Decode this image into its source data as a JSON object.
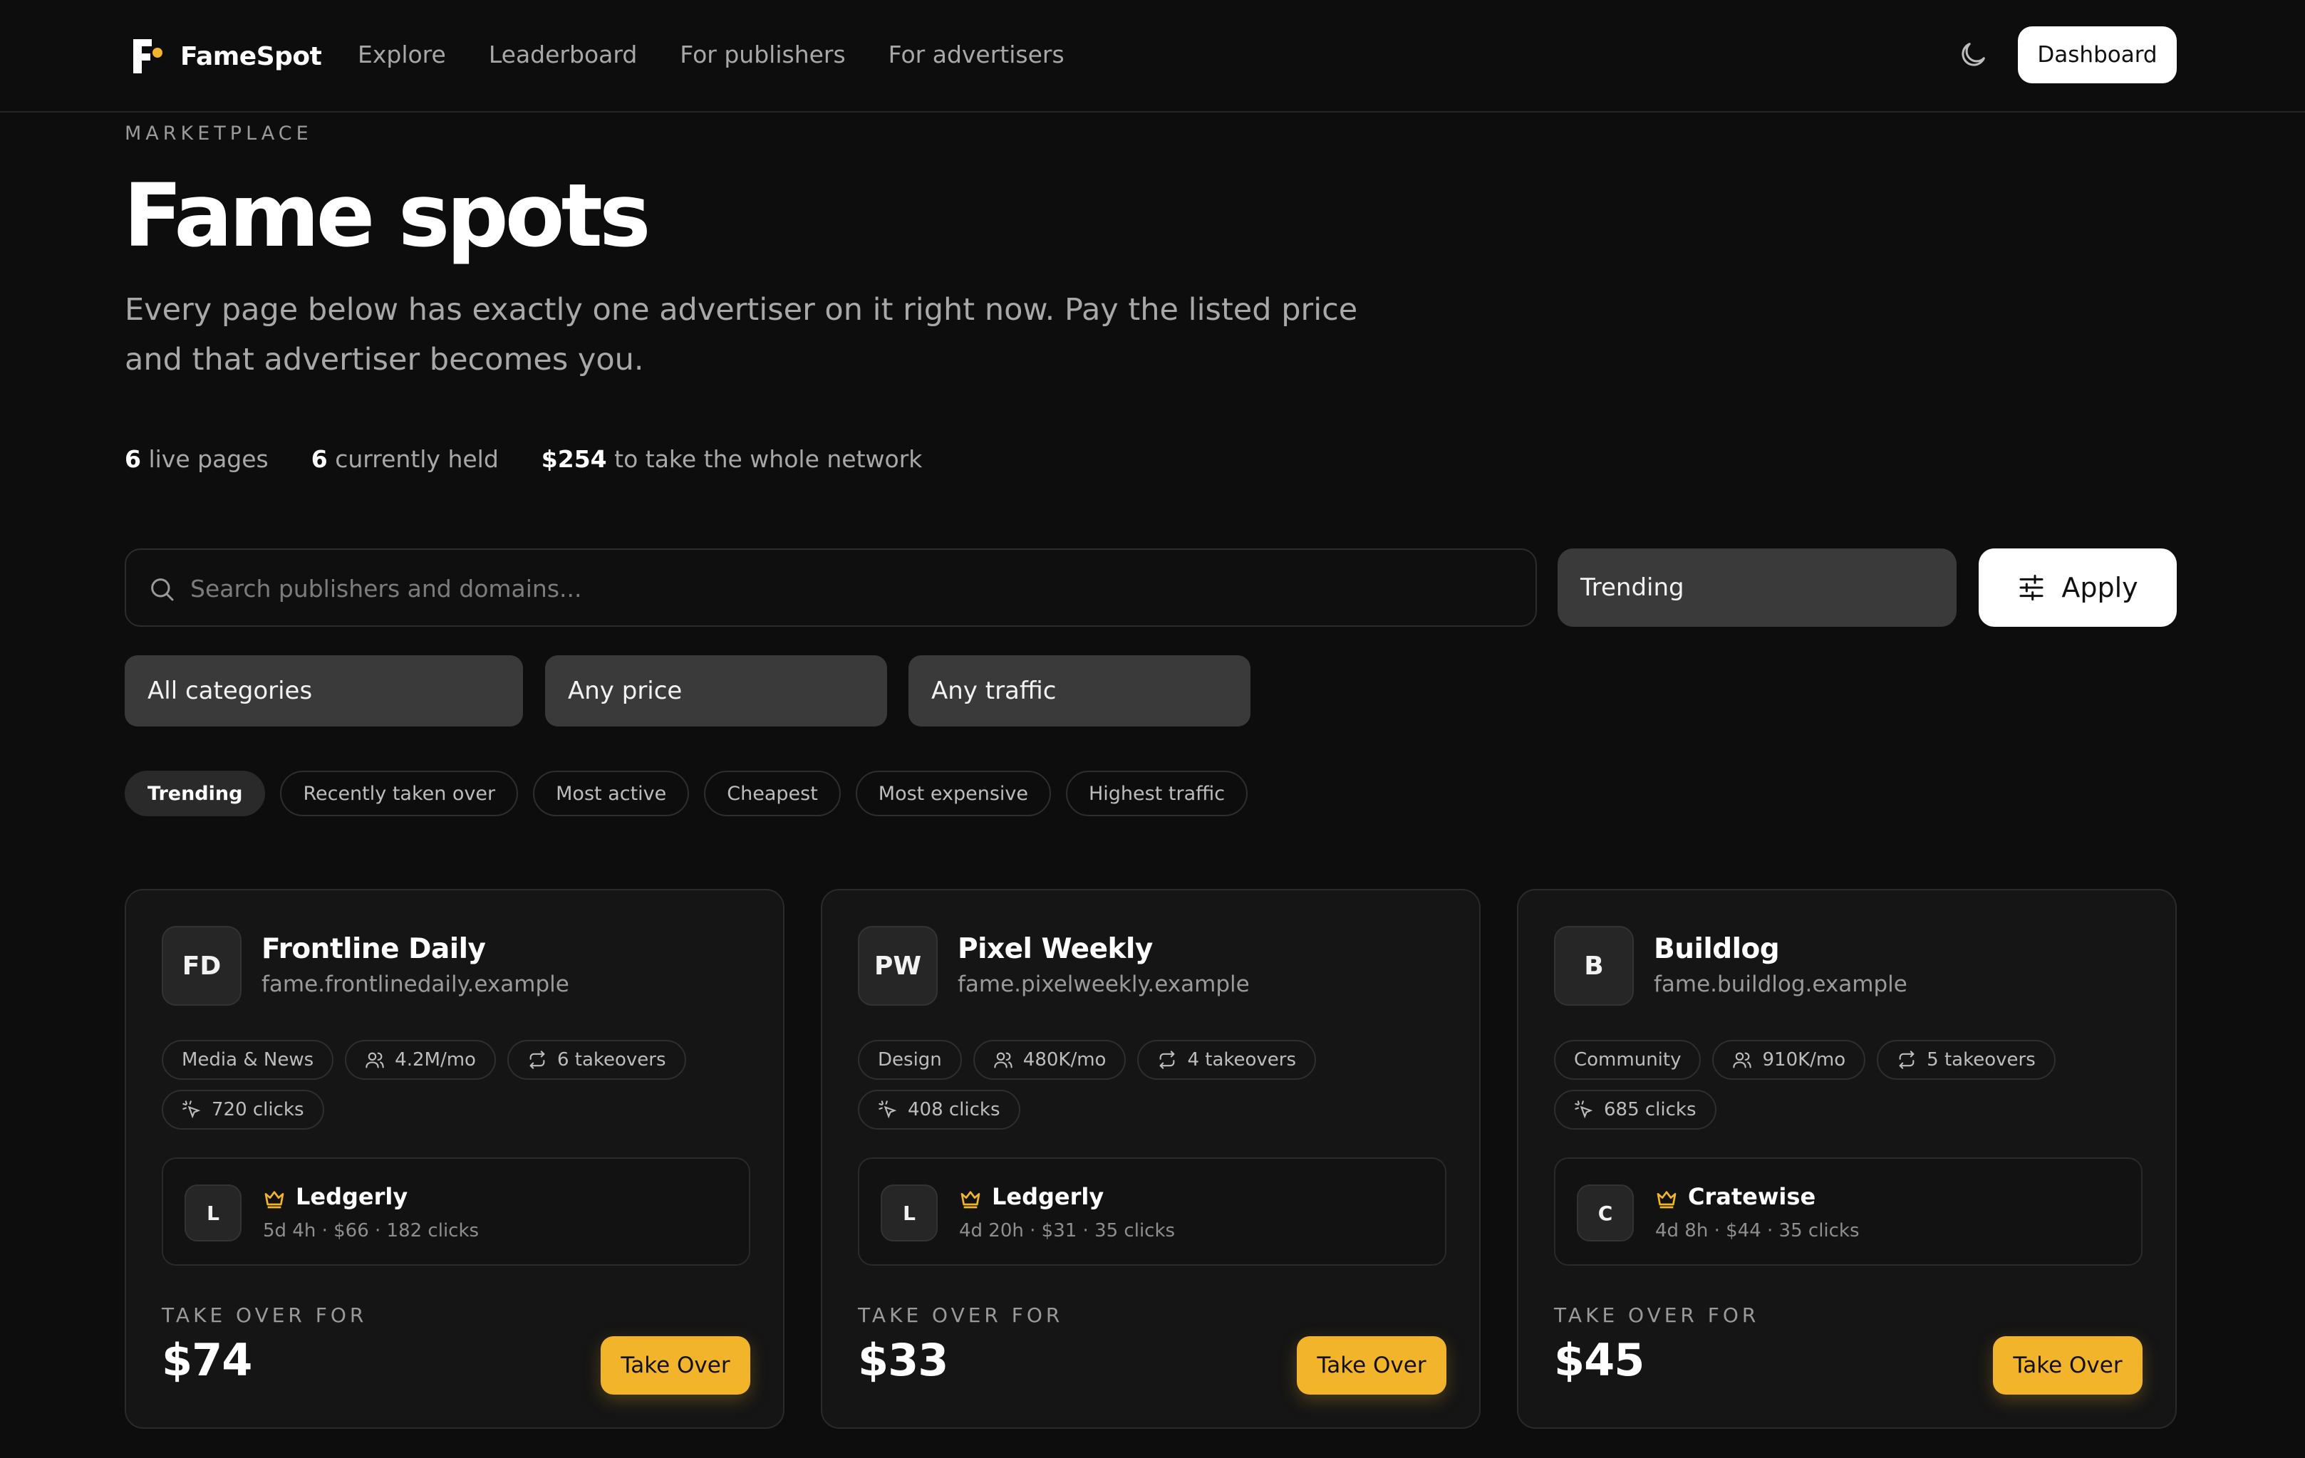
{
  "nav": {
    "brand": "FameSpot",
    "links": [
      "Explore",
      "Leaderboard",
      "For publishers",
      "For advertisers"
    ],
    "dashboard_label": "Dashboard",
    "theme_icon": "moon-icon"
  },
  "hero": {
    "eyebrow": "MARKETPLACE",
    "title": "Fame spots",
    "lede": "Every page below has exactly one advertiser on it right now. Pay the listed price and that advertiser becomes you.",
    "stats": [
      {
        "value": "6",
        "label": "live pages"
      },
      {
        "value": "6",
        "label": "currently held"
      },
      {
        "value": "$254",
        "label": "to take the whole network"
      }
    ]
  },
  "search": {
    "placeholder": "Search publishers and domains...",
    "value": "",
    "sort_value": "Trending",
    "apply_label": "Apply"
  },
  "filters": {
    "category": "All categories",
    "price": "Any price",
    "traffic": "Any traffic"
  },
  "sort_pills": {
    "active": "Trending",
    "items": [
      "Trending",
      "Recently taken over",
      "Most active",
      "Cheapest",
      "Most expensive",
      "Highest traffic"
    ]
  },
  "colors": {
    "background": "#0d0d0d",
    "card": "#151515",
    "accent": "#f2b42b",
    "text_muted": "#9a9a9a"
  },
  "cards": [
    {
      "initials": "FD",
      "name": "Frontline Daily",
      "domain": "fame.frontlinedaily.example",
      "category": "Media & News",
      "traffic": "4.2M/mo",
      "takeovers": "6 takeovers",
      "clicks": "720 clicks",
      "holder": {
        "initial": "L",
        "name": "Ledgerly",
        "meta": "5d 4h · $66 · 182 clicks"
      },
      "take_label": "TAKE OVER FOR",
      "price": "$74",
      "button": "Take Over"
    },
    {
      "initials": "PW",
      "name": "Pixel Weekly",
      "domain": "fame.pixelweekly.example",
      "category": "Design",
      "traffic": "480K/mo",
      "takeovers": "4 takeovers",
      "clicks": "408 clicks",
      "holder": {
        "initial": "L",
        "name": "Ledgerly",
        "meta": "4d 20h · $31 · 35 clicks"
      },
      "take_label": "TAKE OVER FOR",
      "price": "$33",
      "button": "Take Over"
    },
    {
      "initials": "B",
      "name": "Buildlog",
      "domain": "fame.buildlog.example",
      "category": "Community",
      "traffic": "910K/mo",
      "takeovers": "5 takeovers",
      "clicks": "685 clicks",
      "holder": {
        "initial": "C",
        "name": "Cratewise",
        "meta": "4d 8h · $44 · 35 clicks"
      },
      "take_label": "TAKE OVER FOR",
      "price": "$45",
      "button": "Take Over"
    }
  ]
}
